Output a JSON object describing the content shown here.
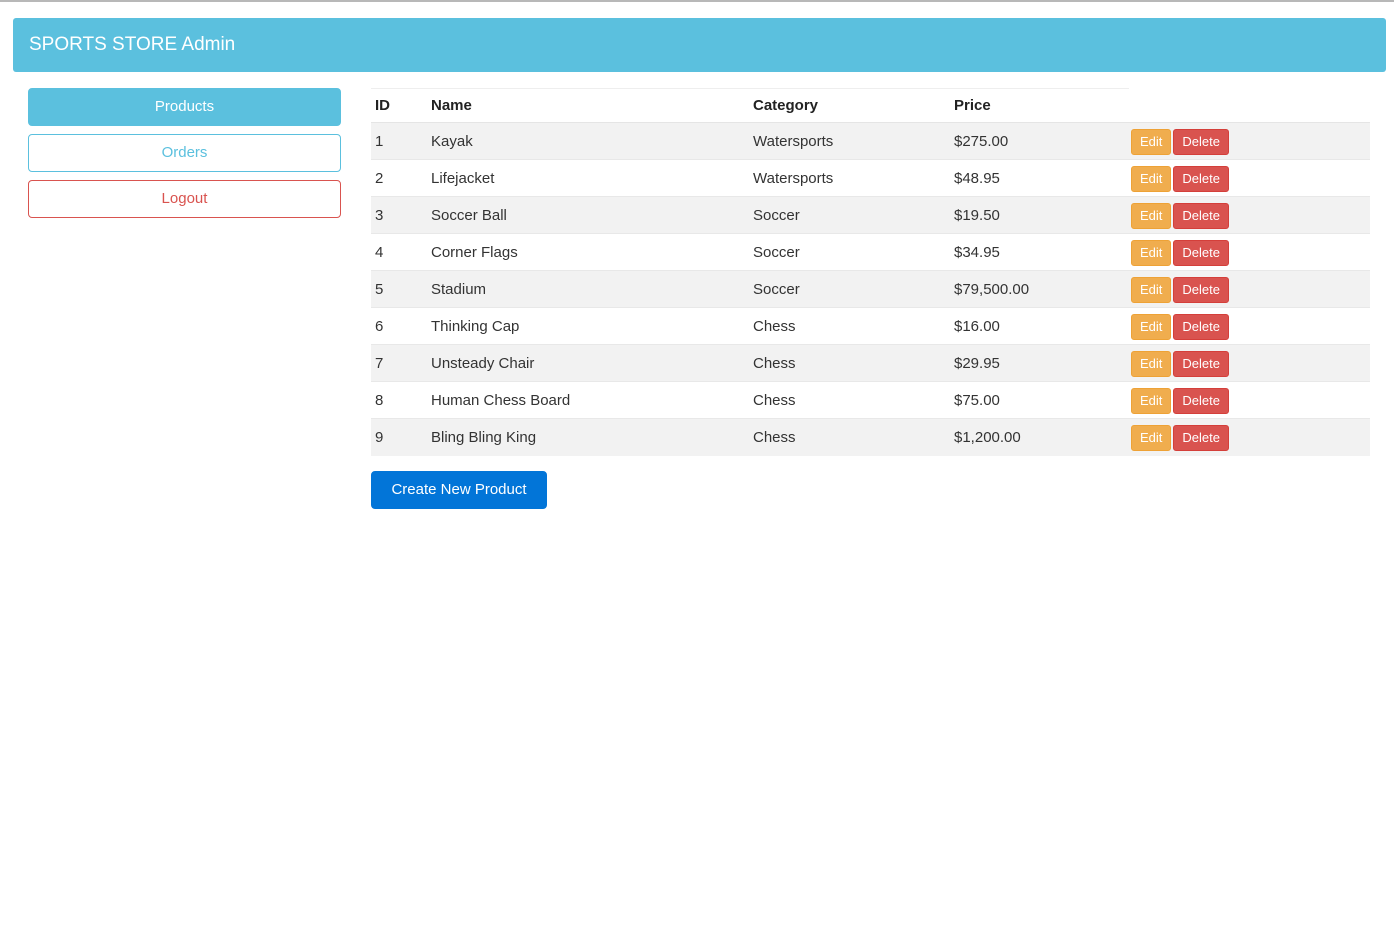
{
  "header": {
    "title": "SPORTS STORE Admin"
  },
  "nav": {
    "products_label": "Products",
    "orders_label": "Orders",
    "logout_label": "Logout"
  },
  "table": {
    "columns": [
      "ID",
      "Name",
      "Category",
      "Price"
    ],
    "edit_label": "Edit",
    "delete_label": "Delete",
    "rows": [
      {
        "id": "1",
        "name": "Kayak",
        "category": "Watersports",
        "price": "$275.00"
      },
      {
        "id": "2",
        "name": "Lifejacket",
        "category": "Watersports",
        "price": "$48.95"
      },
      {
        "id": "3",
        "name": "Soccer Ball",
        "category": "Soccer",
        "price": "$19.50"
      },
      {
        "id": "4",
        "name": "Corner Flags",
        "category": "Soccer",
        "price": "$34.95"
      },
      {
        "id": "5",
        "name": "Stadium",
        "category": "Soccer",
        "price": "$79,500.00"
      },
      {
        "id": "6",
        "name": "Thinking Cap",
        "category": "Chess",
        "price": "$16.00"
      },
      {
        "id": "7",
        "name": "Unsteady Chair",
        "category": "Chess",
        "price": "$29.95"
      },
      {
        "id": "8",
        "name": "Human Chess Board",
        "category": "Chess",
        "price": "$75.00"
      },
      {
        "id": "9",
        "name": "Bling Bling King",
        "category": "Chess",
        "price": "$1,200.00"
      }
    ]
  },
  "create_button_label": "Create New Product",
  "colors": {
    "header_bg": "#5bc0de",
    "info": "#5bc0de",
    "danger": "#d9534f",
    "warning": "#f0ad4e",
    "primary": "#0275d8"
  }
}
